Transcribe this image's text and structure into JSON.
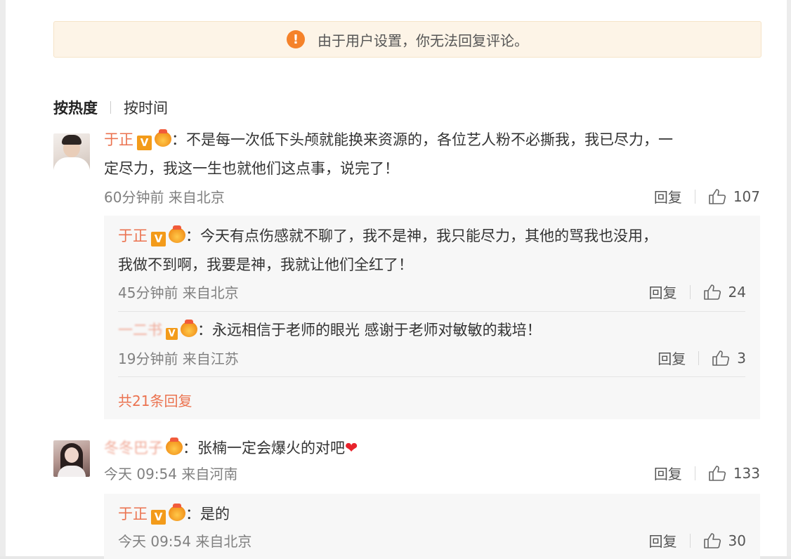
{
  "notice": {
    "icon": "warning-icon",
    "text": "由于用户设置，你无法回复评论。"
  },
  "sort": {
    "hot": "按热度",
    "time": "按时间"
  },
  "comments": [
    {
      "user": "于正",
      "verified_badge": "V",
      "text_line1": "：不是每一次低下头颅就能换来资源的，各位艺人粉不必撕我，我已尽力，一",
      "text_line2": "定尽力，我这一生也就他们这点事，说完了！",
      "meta": "60分钟前 来自北京",
      "reply_label": "回复",
      "likes": "107",
      "replies": [
        {
          "user": "于正",
          "verified_badge": "V",
          "text_line1": "：今天有点伤感就不聊了，我不是神，我只能尽力，其他的骂我也没用，",
          "text_line2": "我做不到啊，我要是神，我就让他们全红了！",
          "meta": "45分钟前 来自北京",
          "reply_label": "回复",
          "likes": "24"
        },
        {
          "user": "一二书",
          "verified_badge": "V",
          "text": "：永远相信于老师的眼光 感谢于老师对敏敏的栽培！",
          "meta": "19分钟前 来自江苏",
          "reply_label": "回复",
          "likes": "3"
        }
      ],
      "more_replies": "共21条回复"
    },
    {
      "user": "冬冬巴子",
      "text": "：张楠一定会爆火的对吧",
      "meta": "今天 09:54 来自河南",
      "reply_label": "回复",
      "likes": "133",
      "replies": [
        {
          "user": "于正",
          "verified_badge": "V",
          "text": "：是的",
          "meta": "今天 09:54 来自北京",
          "reply_label": "回复",
          "likes": "30"
        }
      ]
    }
  ],
  "colors": {
    "username": "#eb7350",
    "notice_bg": "#fdf4e7",
    "warning": "#f5822a",
    "badge": "#f39b1a"
  }
}
